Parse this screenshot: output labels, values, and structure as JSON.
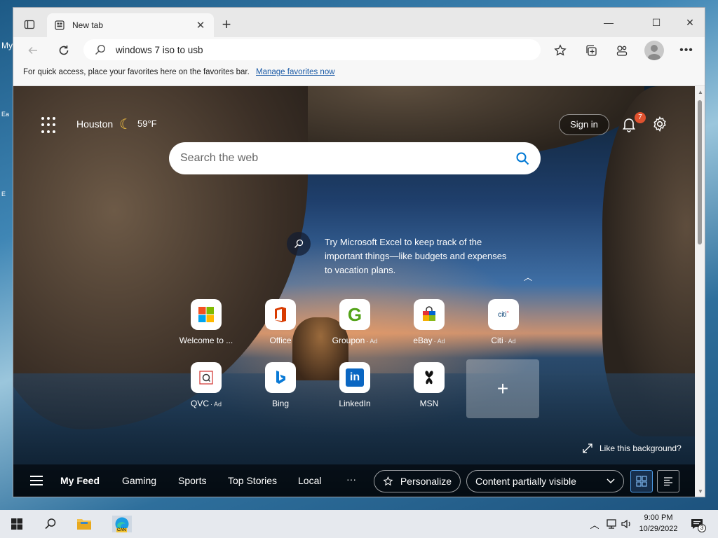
{
  "desktop": {
    "left_glyphs": [
      "My",
      "Ea",
      "E"
    ]
  },
  "browser": {
    "tab": {
      "title": "New tab"
    },
    "address": {
      "value": "windows 7 iso to usb"
    },
    "favorites_bar": {
      "message": "For quick access, place your favorites here on the favorites bar.",
      "link": "Manage favorites now"
    }
  },
  "newtab": {
    "weather": {
      "city": "Houston",
      "temp": "59°F",
      "icon": "moon-icon"
    },
    "sign_in": "Sign in",
    "notifications": {
      "count": "7"
    },
    "search": {
      "placeholder": "Search the web"
    },
    "tip": "Try Microsoft Excel to keep track of the important things—like budgets and expenses to vacation plans.",
    "tiles": [
      {
        "label": "Welcome to ...",
        "ad": "",
        "icon": "microsoft-logo-icon"
      },
      {
        "label": "Office",
        "ad": "",
        "icon": "office-logo-icon"
      },
      {
        "label": "Groupon",
        "ad": "· Ad",
        "icon": "groupon-logo-icon"
      },
      {
        "label": "eBay",
        "ad": "· Ad",
        "icon": "ebay-bag-icon"
      },
      {
        "label": "Citi",
        "ad": "· Ad",
        "icon": "citi-logo-icon"
      },
      {
        "label": "QVC",
        "ad": "· Ad",
        "icon": "qvc-logo-icon"
      },
      {
        "label": "Bing",
        "ad": "",
        "icon": "bing-logo-icon"
      },
      {
        "label": "LinkedIn",
        "ad": "",
        "icon": "linkedin-logo-icon"
      },
      {
        "label": "MSN",
        "ad": "",
        "icon": "msn-logo-icon"
      }
    ],
    "like_background": "Like this background?",
    "feed": {
      "items": [
        "My Feed",
        "Gaming",
        "Sports",
        "Top Stories",
        "Local"
      ],
      "more": "···",
      "personalize": "Personalize",
      "content_visibility": "Content partially visible"
    }
  },
  "taskbar": {
    "time": "9:00 PM",
    "date": "10/29/2022",
    "notifications": "3",
    "edge_badge": "CAN"
  },
  "colors": {
    "accent": "#0078d4",
    "badge": "#e0522f"
  }
}
